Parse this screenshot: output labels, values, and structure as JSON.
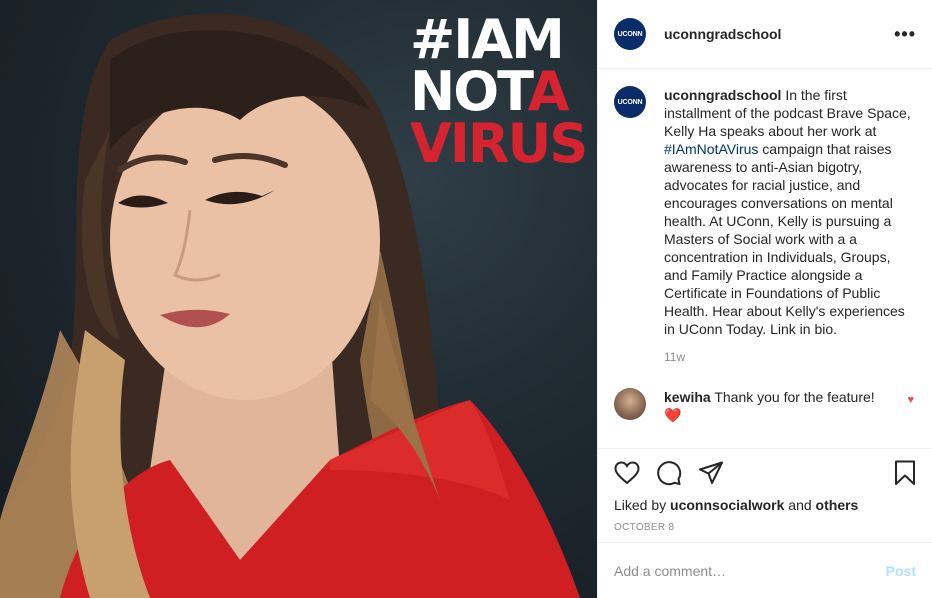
{
  "media": {
    "overlay_lines": [
      {
        "text": "#IAM",
        "color": "#ffffff"
      },
      {
        "text_white": "NOT",
        "text_red": "A"
      },
      {
        "text": "VIRUS",
        "color": "#d5232f"
      }
    ]
  },
  "header": {
    "logo_text": "UCONN",
    "username": "uconngradschool",
    "more_icon": "more-horizontal-icon",
    "more_label": "•••"
  },
  "caption": {
    "username": "uconngradschool",
    "text_before": " In the first installment of the podcast Brave Space, Kelly Ha speaks about her work at ",
    "hashtag": "#IAmNotAVirus",
    "text_after": " campaign that raises awareness to anti-Asian bigotry, advocates for racial justice, and encourages conversations on mental health. At UConn, Kelly is pursuing a Masters of Social work with a a concentration in Individuals, Groups, and Family Practice alongside a Certificate in Foundations of Public Health. Hear about Kelly's experiences in UConn Today. Link in bio.",
    "time": "11w"
  },
  "comment": {
    "username": "kewiha",
    "text": " Thank you for the feature! ",
    "emoji": "❤️",
    "like_icon": "heart-icon"
  },
  "actions": {
    "icons": [
      "heart-icon",
      "comment-icon",
      "share-icon",
      "bookmark-icon"
    ],
    "liked_by_prefix": "Liked by ",
    "liked_by_user": "uconnsocialwork",
    "liked_by_middle": " and ",
    "liked_by_others": "others",
    "date": "OCTOBER 8"
  },
  "add_comment": {
    "placeholder": "Add a comment…",
    "post_label": "Post"
  },
  "colors": {
    "brand_navy": "#0a2c6b",
    "hashtag_link": "#00376b",
    "like_red": "#ed4956",
    "post_disabled": "#b2dffc",
    "overlay_red": "#d5232f"
  }
}
